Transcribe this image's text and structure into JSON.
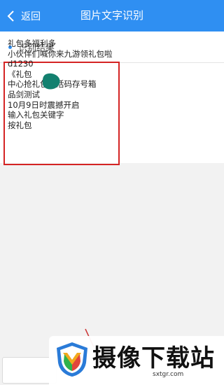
{
  "header": {
    "back_label": "返回",
    "title": "图片文字识别"
  },
  "section": {
    "label": "识别结果",
    "lines": [
      "礼包多福利多",
      "小伙伴们喊你来九游领礼包啦",
      "d1230",
      "《礼包",
      "中心抢礼包激活码存号箱",
      "品剑测试",
      "10月9日时震撼开启",
      "输入礼包关键字",
      "按礼包"
    ]
  },
  "watermark": {
    "text": "摄像下载站",
    "url": "sxtgr.com"
  },
  "colors": {
    "header": "#2f8ff2",
    "highlight_border": "#d42424",
    "accent_dot": "#2f8ff2",
    "blob": "#13806f"
  }
}
